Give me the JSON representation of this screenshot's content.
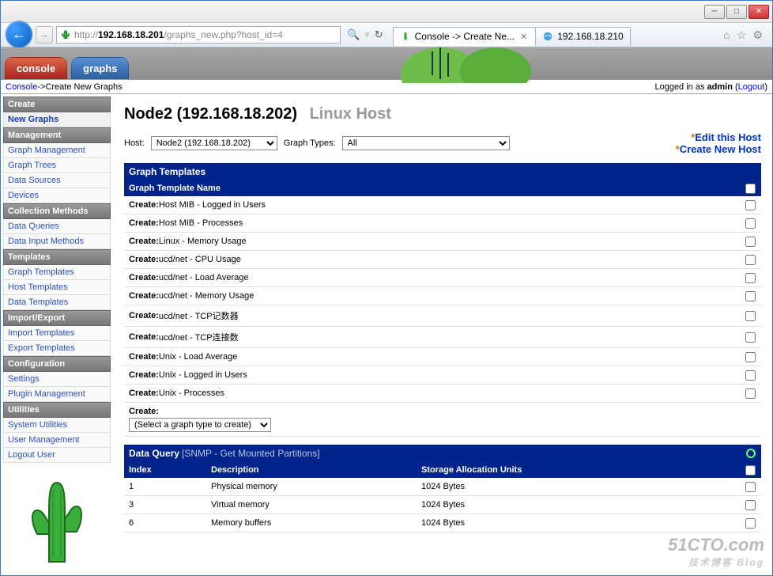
{
  "window": {
    "min": "─",
    "max": "□",
    "close": "✕"
  },
  "browser": {
    "url_host": "192.168.18.201",
    "url_path": "/graphs_new.php?host_id=4",
    "tab1_title": "Console -> Create Ne...",
    "tab2_title": "192.168.18.210"
  },
  "tabs": {
    "console": "console",
    "graphs": "graphs"
  },
  "breadcrumb": {
    "console": "Console",
    "arrow": " -> ",
    "page": "Create New Graphs",
    "logged_prefix": "Logged in as ",
    "user": "admin",
    "logout": "Logout"
  },
  "sidebar": {
    "sections": [
      {
        "title": "Create",
        "items": [
          "New Graphs"
        ],
        "active": 0
      },
      {
        "title": "Management",
        "items": [
          "Graph Management",
          "Graph Trees",
          "Data Sources",
          "Devices"
        ]
      },
      {
        "title": "Collection Methods",
        "items": [
          "Data Queries",
          "Data Input Methods"
        ]
      },
      {
        "title": "Templates",
        "items": [
          "Graph Templates",
          "Host Templates",
          "Data Templates"
        ]
      },
      {
        "title": "Import/Export",
        "items": [
          "Import Templates",
          "Export Templates"
        ]
      },
      {
        "title": "Configuration",
        "items": [
          "Settings",
          "Plugin Management"
        ]
      },
      {
        "title": "Utilities",
        "items": [
          "System Utilities",
          "User Management",
          "Logout User"
        ]
      }
    ]
  },
  "page": {
    "title": "Node2 (192.168.18.202)",
    "subtitle": "Linux Host",
    "host_label": "Host:",
    "host_value": "Node2 (192.168.18.202)",
    "gt_label": "Graph Types:",
    "gt_value": "All",
    "edit_host": "Edit this Host",
    "create_host": "Create New Host"
  },
  "templates": {
    "header": "Graph Templates",
    "col_name": "Graph Template Name",
    "create_prefix": "Create:",
    "select_label": "Create:",
    "select_value": "(Select a graph type to create)",
    "rows": [
      "Host MIB - Logged in Users",
      "Host MIB - Processes",
      "Linux - Memory Usage",
      "ucd/net - CPU Usage",
      "ucd/net - Load Average",
      "ucd/net - Memory Usage",
      "ucd/net - TCP记数器",
      "ucd/net - TCP连接数",
      "Unix - Load Average",
      "Unix - Logged in Users",
      "Unix - Processes"
    ]
  },
  "dataquery": {
    "header": "Data Query",
    "sub": "[SNMP - Get Mounted Partitions]",
    "cols": {
      "idx": "Index",
      "desc": "Description",
      "sau": "Storage Allocation Units"
    },
    "rows": [
      {
        "idx": "1",
        "desc": "Physical memory",
        "sau": "1024 Bytes"
      },
      {
        "idx": "3",
        "desc": "Virtual memory",
        "sau": "1024 Bytes"
      },
      {
        "idx": "6",
        "desc": "Memory buffers",
        "sau": "1024 Bytes"
      }
    ]
  },
  "watermark": {
    "main": "51CTO.com",
    "sub": "技术博客  Blog"
  }
}
